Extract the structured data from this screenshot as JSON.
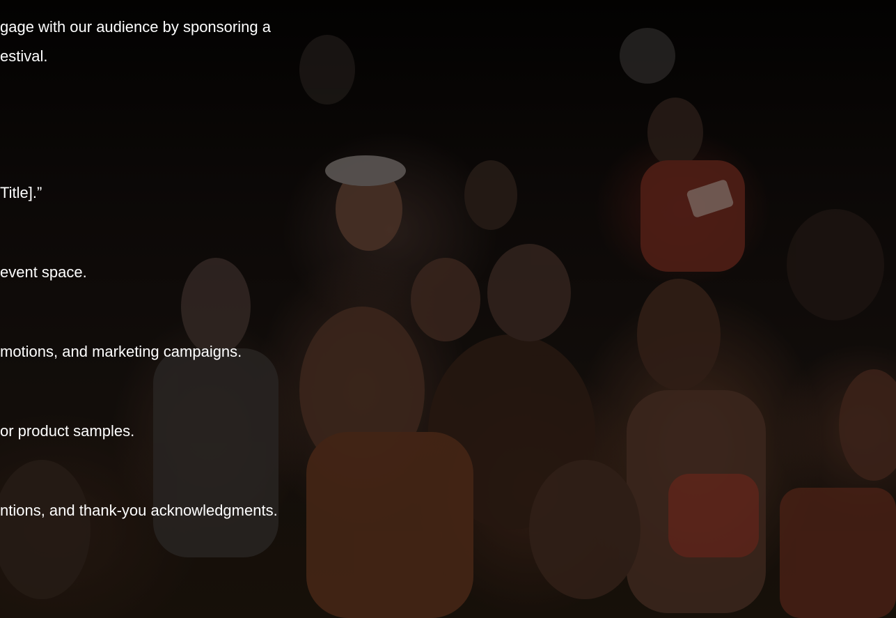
{
  "intro": {
    "line1": "gage with our audience by sponsoring a",
    "line2": "estival."
  },
  "benefits": [
    {
      "text": "Title].”"
    },
    {
      "text": "event space."
    },
    {
      "text": "motions, and marketing campaigns."
    },
    {
      "text": "or product samples."
    },
    {
      "text": "ntions, and thank-you acknowledgments."
    }
  ],
  "background": {
    "image": "crowd-photo",
    "overlay_color": "#000000"
  }
}
